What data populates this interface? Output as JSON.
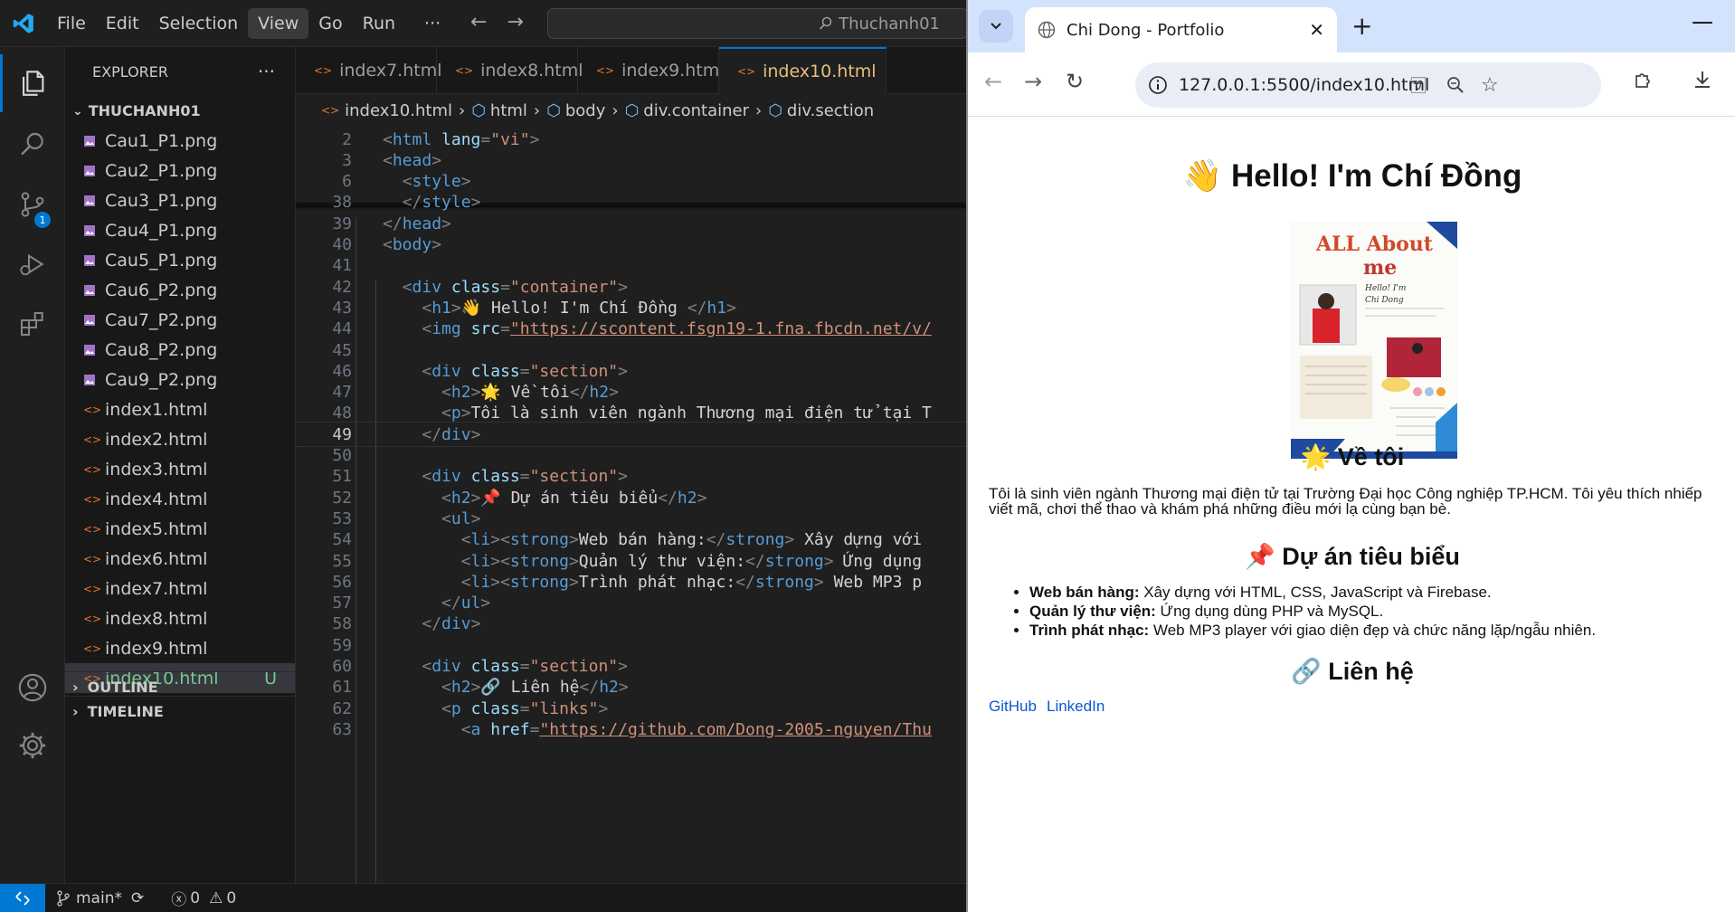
{
  "vscode": {
    "menu": [
      "File",
      "Edit",
      "Selection",
      "View",
      "Go",
      "Run",
      "···"
    ],
    "active_menu_index": 3,
    "search_text": "Thuchanh01",
    "scm_badge": "1",
    "explorer_title": "EXPLORER",
    "explorer_more": "···",
    "folder_name": "THUCHANH01",
    "files": [
      {
        "name": "Cau1_P1.png",
        "kind": "png"
      },
      {
        "name": "Cau2_P1.png",
        "kind": "png"
      },
      {
        "name": "Cau3_P1.png",
        "kind": "png"
      },
      {
        "name": "Cau4_P1.png",
        "kind": "png"
      },
      {
        "name": "Cau5_P1.png",
        "kind": "png"
      },
      {
        "name": "Cau6_P2.png",
        "kind": "png"
      },
      {
        "name": "Cau7_P2.png",
        "kind": "png"
      },
      {
        "name": "Cau8_P2.png",
        "kind": "png"
      },
      {
        "name": "Cau9_P2.png",
        "kind": "png"
      },
      {
        "name": "index1.html",
        "kind": "html"
      },
      {
        "name": "index2.html",
        "kind": "html"
      },
      {
        "name": "index3.html",
        "kind": "html"
      },
      {
        "name": "index4.html",
        "kind": "html"
      },
      {
        "name": "index5.html",
        "kind": "html"
      },
      {
        "name": "index6.html",
        "kind": "html"
      },
      {
        "name": "index7.html",
        "kind": "html"
      },
      {
        "name": "index8.html",
        "kind": "html"
      },
      {
        "name": "index9.html",
        "kind": "html"
      },
      {
        "name": "index10.html",
        "kind": "html",
        "selected": true,
        "status": "U"
      }
    ],
    "outline_label": "OUTLINE",
    "timeline_label": "TIMELINE",
    "tabs": [
      {
        "label": "index7.html",
        "active": false
      },
      {
        "label": "index8.html",
        "active": false
      },
      {
        "label": "index9.html",
        "active": false
      },
      {
        "label": "index10.html",
        "active": true
      }
    ],
    "breadcrumb": [
      "index10.html",
      "html",
      "body",
      "div.container",
      "div.section"
    ],
    "current_line": "49",
    "code_lines": [
      {
        "n": "2",
        "t": "<html lang=\"vi\">"
      },
      {
        "n": "3",
        "t": "<head>"
      },
      {
        "n": "6",
        "t": "  <style>"
      },
      {
        "n": "38",
        "t": "  </style>"
      },
      {
        "n": "39",
        "t": "</head>"
      },
      {
        "n": "40",
        "t": "<body>"
      },
      {
        "n": "41",
        "t": ""
      },
      {
        "n": "42",
        "t": "  <div class=\"container\">"
      },
      {
        "n": "43",
        "t": "    <h1>👋 Hello! I'm Chí Đồng </h1>"
      },
      {
        "n": "44",
        "t": "    <img src=\"https://scontent.fsgn19-1.fna.fbcdn.net/v/"
      },
      {
        "n": "45",
        "t": ""
      },
      {
        "n": "46",
        "t": "    <div class=\"section\">"
      },
      {
        "n": "47",
        "t": "      <h2>🌟 Về tôi</h2>"
      },
      {
        "n": "48",
        "t": "      <p>Tôi là sinh viên ngành Thương mại điện tử tại T"
      },
      {
        "n": "49",
        "t": "    </div>"
      },
      {
        "n": "50",
        "t": ""
      },
      {
        "n": "51",
        "t": "    <div class=\"section\">"
      },
      {
        "n": "52",
        "t": "      <h2>📌 Dự án tiêu biểu</h2>"
      },
      {
        "n": "53",
        "t": "      <ul>"
      },
      {
        "n": "54",
        "t": "        <li><strong>Web bán hàng:</strong> Xây dựng với"
      },
      {
        "n": "55",
        "t": "        <li><strong>Quản lý thư viện:</strong> Ứng dụng"
      },
      {
        "n": "56",
        "t": "        <li><strong>Trình phát nhạc:</strong> Web MP3 p"
      },
      {
        "n": "57",
        "t": "      </ul>"
      },
      {
        "n": "58",
        "t": "    </div>"
      },
      {
        "n": "59",
        "t": ""
      },
      {
        "n": "60",
        "t": "    <div class=\"section\">"
      },
      {
        "n": "61",
        "t": "      <h2>🔗 Liên hệ</h2>"
      },
      {
        "n": "62",
        "t": "      <p class=\"links\">"
      },
      {
        "n": "63",
        "t": "        <a href=\"https://github.com/Dong-2005-nguyen/Thu"
      }
    ],
    "status": {
      "branch": "main*",
      "errors": "0",
      "warnings": "0"
    }
  },
  "chrome": {
    "tab_title": "Chi Dong - Portfolio",
    "url": "127.0.0.1:5500/index10.html"
  },
  "page": {
    "h1": "👋 Hello! I'm Chí Đồng",
    "about_card": {
      "title1": "ALL About",
      "title2": "me",
      "hello": "Hello! I'm",
      "name": "Chi Dong",
      "hobby": "My hobby",
      "things": "Things that make me happy:",
      "list": [
        "Photography",
        "Cooking Code",
        "Weekend Adventures",
        "Time with Friends"
      ],
      "favorite": "Favorite colors"
    },
    "about_heading": "🌟 Về tôi",
    "about_text_line1": "Tôi là sinh viên ngành Thương mại điện tử tại Trường Đại học Công nghiệp TP.HCM. Tôi yêu thích nhiếp",
    "about_text_line2": "viết mã, chơi thể thao và khám phá những điều mới lạ cùng bạn bè.",
    "projects_heading": "📌 Dự án tiêu biểu",
    "projects": [
      {
        "name": "Web bán hàng:",
        "desc": " Xây dựng với HTML, CSS, JavaScript và Firebase."
      },
      {
        "name": "Quản lý thư viện:",
        "desc": " Ứng dụng dùng PHP và MySQL."
      },
      {
        "name": "Trình phát nhạc:",
        "desc": " Web MP3 player với giao diện đẹp và chức năng lặp/ngẫu nhiên."
      }
    ],
    "contact_heading": "🔗 Liên hệ",
    "links": [
      "GitHub",
      "LinkedIn"
    ]
  },
  "colors": {
    "vscode_accent": "#0078d4",
    "tab_active_text": "#e5c07b",
    "link": "#0b57d0",
    "chrome_tabstrip": "#d3e3fd"
  }
}
